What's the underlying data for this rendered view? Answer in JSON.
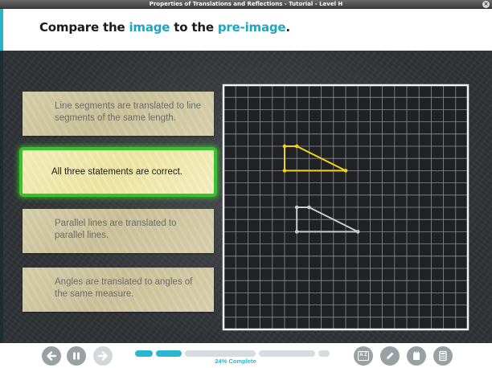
{
  "window": {
    "title": "Properties of Translations and Reflections - Tutorial - Level H",
    "close_glyph": "×"
  },
  "header": {
    "prompt_before": "Compare the ",
    "prompt_image": "image",
    "prompt_middle": " to the ",
    "prompt_preimage": "pre-image",
    "prompt_after": ".",
    "accent_color": "#1fa6bd"
  },
  "choices": [
    {
      "label": "Line segments are translated to line segments of the same length.",
      "selected": false
    },
    {
      "label": "All three statements are correct.",
      "selected": true
    },
    {
      "label": "Parallel lines are translated to parallel lines.",
      "selected": false
    },
    {
      "label": "Angles are translated to angles of the same measure.",
      "selected": false
    }
  ],
  "grid": {
    "columns": 20,
    "rows": 20,
    "image_color": "#f2d21a",
    "preimage_color": "#c9cdd0",
    "image_vertices": [
      [
        5,
        5
      ],
      [
        6,
        5
      ],
      [
        10,
        7
      ],
      [
        5,
        7
      ]
    ],
    "preimage_vertices": [
      [
        6,
        10
      ],
      [
        7,
        10
      ],
      [
        11,
        12
      ],
      [
        6,
        12
      ]
    ]
  },
  "toolbar": {
    "back_icon": "arrow-left-icon",
    "pause_icon": "pause-icon",
    "forward_icon": "arrow-right-icon",
    "progress_percent": 24,
    "progress_label": "24% Complete",
    "glossary_icon": "glossary-icon",
    "glossary_label": "A Z",
    "pencil_icon": "pencil-icon",
    "notepad_icon": "notepad-icon",
    "calculator_icon": "calculator-icon",
    "accent_color": "#2bb7d1"
  }
}
